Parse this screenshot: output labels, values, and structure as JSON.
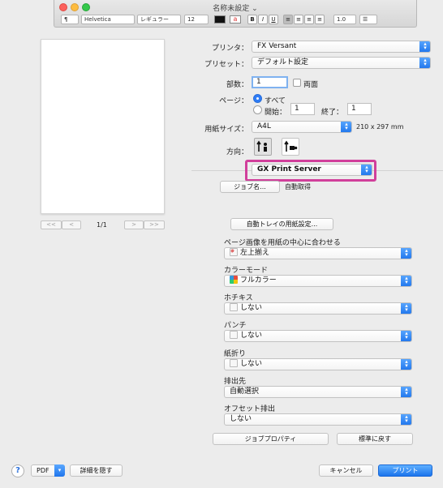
{
  "window": {
    "title": "名称未設定"
  },
  "toolbar": {
    "paragraph": "¶",
    "font": "Helvetica",
    "style": "レギュラー",
    "size": "12",
    "bold": "B",
    "italic": "I",
    "underline": "U",
    "spacing": "1.0"
  },
  "preview": {
    "page_indicator": "1/1",
    "first": "<<",
    "prev": "<",
    "next": ">",
    "last": ">>"
  },
  "printer": {
    "label": "プリンタ：",
    "value": "FX Versant"
  },
  "presets": {
    "label": "プリセット：",
    "value": "デフォルト設定"
  },
  "copies": {
    "label": "部数：",
    "value": "1",
    "duplex_label": "両面"
  },
  "pages": {
    "label": "ページ：",
    "all_label": "すべて",
    "from_label": "開始：",
    "from_value": "1",
    "to_label": "終了：",
    "to_value": "1"
  },
  "paper": {
    "label": "用紙サイズ：",
    "value": "A4L",
    "dimensions": "210 x 297 mm"
  },
  "orientation": {
    "label": "方向："
  },
  "section": {
    "value": "GX Print Server"
  },
  "job": {
    "button_label": "ジョブ名...",
    "auto_label": "自動取得"
  },
  "auto_tray": {
    "button_label": "自動トレイの用紙設定..."
  },
  "center_image": {
    "label": "ページ画像を用紙の中心に合わせる",
    "value": "左上揃え"
  },
  "color_mode": {
    "label": "カラーモード",
    "value": "フルカラー"
  },
  "staple": {
    "label": "ホチキス",
    "value": "しない"
  },
  "punch": {
    "label": "パンチ",
    "value": "しない"
  },
  "fold": {
    "label": "紙折り",
    "value": "しない"
  },
  "output": {
    "label": "排出先",
    "value": "自動選択"
  },
  "offset": {
    "label": "オフセット排出",
    "value": "しない"
  },
  "actions": {
    "job_properties": "ジョブプロパティ",
    "restore_defaults": "標準に戻す"
  },
  "footer": {
    "help": "?",
    "pdf": "PDF",
    "hide_details": "詳細を隠す",
    "cancel": "キャンセル",
    "print": "プリント"
  },
  "colors": {
    "accent": "#1f75ec",
    "highlight": "#d13f9b"
  }
}
